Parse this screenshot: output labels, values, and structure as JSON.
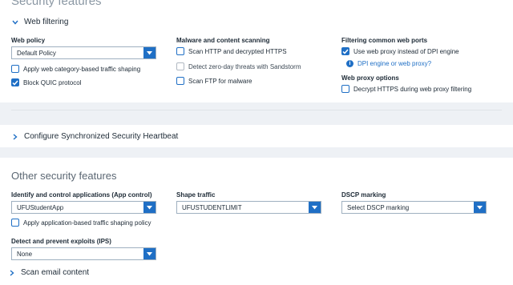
{
  "security_features": {
    "heading": "Security features",
    "web_filtering_toggle": "Web filtering",
    "web_policy": {
      "label": "Web policy",
      "value": "Default Policy",
      "apply_category_shaping": "Apply web category-based traffic shaping",
      "block_quic": "Block QUIC protocol"
    },
    "malware": {
      "label": "Malware and content scanning",
      "scan_http": "Scan HTTP and decrypted HTTPS",
      "detect_zero_day": "Detect zero-day threats with Sandstorm",
      "scan_ftp": "Scan FTP for malware"
    },
    "filtering_ports": {
      "label": "Filtering common web ports",
      "use_proxy": "Use web proxy instead of DPI engine",
      "help_link": "DPI engine or web proxy?"
    },
    "proxy_options": {
      "label": "Web proxy options",
      "decrypt_https": "Decrypt HTTPS during web proxy filtering"
    }
  },
  "heartbeat": {
    "toggle": "Configure Synchronized Security Heartbeat"
  },
  "other_features": {
    "heading": "Other security features",
    "app_control": {
      "label": "Identify and control applications (App control)",
      "value": "UFUStudentApp",
      "shaping_policy": "Apply application-based traffic shaping policy"
    },
    "shape_traffic": {
      "label": "Shape traffic",
      "value": "UFUSTUDENTLIMIT"
    },
    "dscp": {
      "label": "DSCP marking",
      "value": "Select DSCP marking"
    },
    "ips": {
      "label": "Detect and prevent exploits (IPS)",
      "value": "None"
    },
    "scan_email_toggle": "Scan email content"
  },
  "colors": {
    "accent": "#1f6fc5",
    "page_bg": "#eef1f5",
    "panel_bg": "#ffffff"
  }
}
